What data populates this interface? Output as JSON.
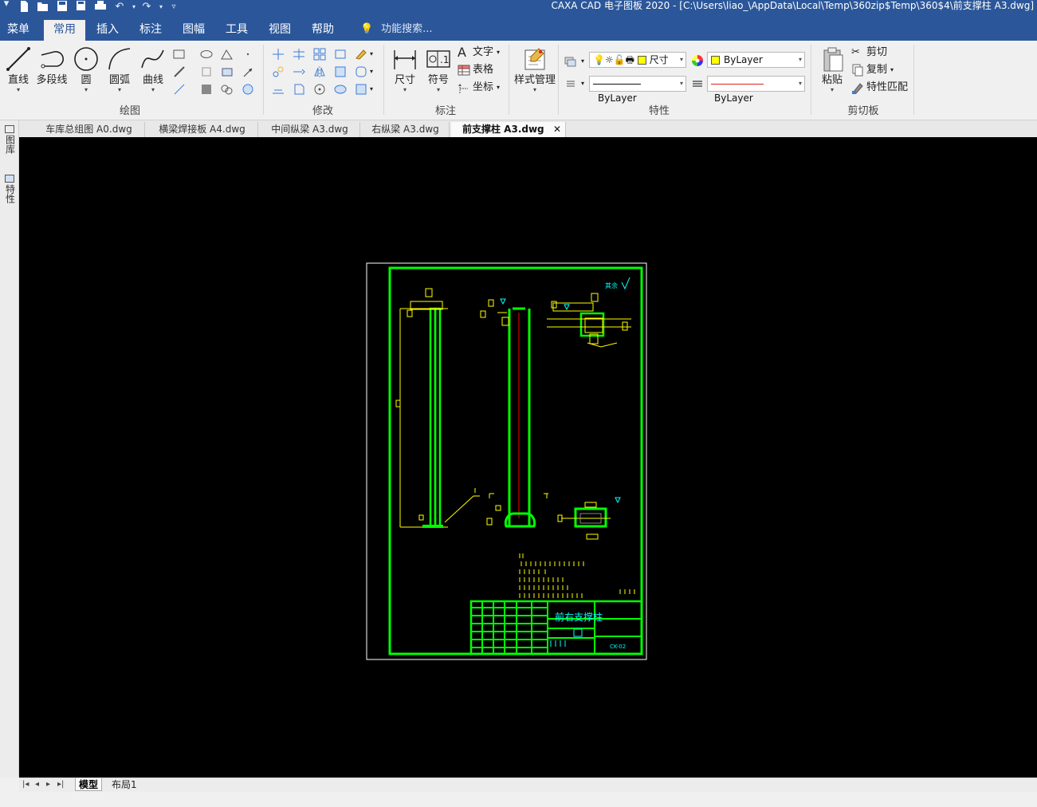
{
  "title": "CAXA CAD 电子图板 2020 - [C:\\Users\\liao_\\AppData\\Local\\Temp\\360zip$Temp\\360$4\\前支撑柱 A3.dwg]",
  "menu": {
    "tabs": [
      "菜单",
      "常用",
      "插入",
      "标注",
      "图幅",
      "工具",
      "视图",
      "帮助"
    ],
    "active": "常用",
    "search_placeholder": "功能搜索..."
  },
  "ribbon": {
    "draw": {
      "label": "绘图",
      "buttons": [
        "直线",
        "多段线",
        "圆",
        "圆弧",
        "曲线"
      ]
    },
    "modify": {
      "label": "修改"
    },
    "annotate": {
      "label": "标注",
      "buttons": [
        "尺寸",
        "符号"
      ],
      "small": [
        "文字",
        "表格",
        "坐标"
      ]
    },
    "style": {
      "label": "样式管理"
    },
    "properties": {
      "label": "特性",
      "text_style": "尺寸",
      "color": "ByLayer",
      "linetype": "ByLayer",
      "linecolor": "ByLayer",
      "accent": "#ffff00"
    },
    "clipboard": {
      "label": "剪切板",
      "paste": "粘贴",
      "small": [
        "剪切",
        "复制",
        "特性匹配"
      ]
    }
  },
  "doc_tabs": [
    "车库总组图 A0.dwg",
    "横梁焊接板 A4.dwg",
    "中间纵梁 A3.dwg",
    "右纵梁 A3.dwg",
    "前支撑柱 A3.dwg"
  ],
  "active_doc": "前支撑柱 A3.dwg",
  "left_panel": [
    "图库",
    "特性"
  ],
  "layout_tabs": [
    "模型",
    "布局1"
  ],
  "drawing": {
    "title_block_name": "前右支撑柱",
    "drawing_no": "CK-02",
    "note": "其余",
    "frame_color": "#00ff00",
    "dim_color": "#ffff00",
    "text_color": "#00ffff",
    "center_color": "#ff0000"
  }
}
